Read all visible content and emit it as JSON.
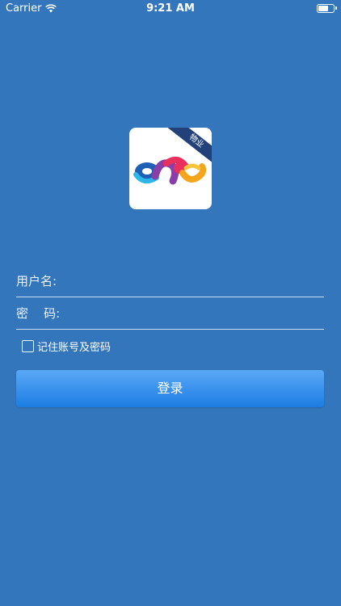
{
  "status_bar": {
    "carrier": "Carrier",
    "time": "9:21 AM"
  },
  "logo": {
    "badge": "物业",
    "colors": [
      "#1f5fb5",
      "#e9305d",
      "#8a3fa8",
      "#f4a51c",
      "#2db6e8"
    ]
  },
  "form": {
    "username_label": "用户名:",
    "username_value": "",
    "password_label": "密    码:",
    "password_value": "",
    "remember_label": "记住账号及密码",
    "remember_checked": false,
    "login_label": "登录"
  },
  "colors": {
    "background": "#3476bb",
    "button_top": "#5aa8f5",
    "button_bottom": "#1c7de3"
  }
}
